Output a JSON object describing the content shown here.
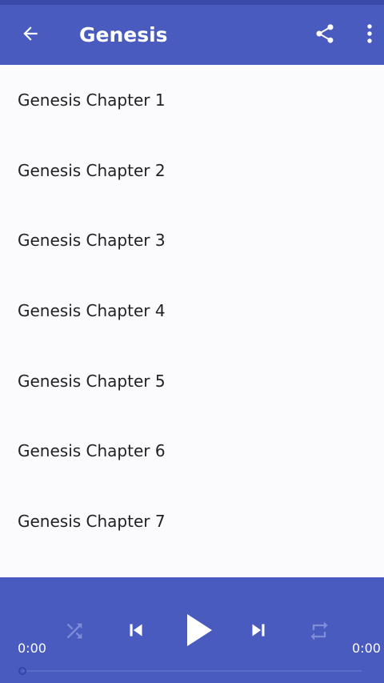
{
  "appbar": {
    "title": "Genesis",
    "back_icon": "arrow-left-icon",
    "share_icon": "share-icon",
    "more_icon": "more-vertical-icon",
    "color": "#4a5bbf"
  },
  "chapters": [
    {
      "label": "Genesis Chapter 1"
    },
    {
      "label": "Genesis Chapter 2"
    },
    {
      "label": "Genesis Chapter 3"
    },
    {
      "label": "Genesis Chapter 4"
    },
    {
      "label": "Genesis Chapter 5"
    },
    {
      "label": "Genesis Chapter 6"
    },
    {
      "label": "Genesis Chapter 7"
    }
  ],
  "player": {
    "elapsed": "0:00",
    "duration": "0:00",
    "progress": 0,
    "shuffle_icon": "shuffle-icon",
    "previous_icon": "skip-previous-icon",
    "play_icon": "play-icon",
    "next_icon": "skip-next-icon",
    "repeat_icon": "repeat-icon"
  }
}
